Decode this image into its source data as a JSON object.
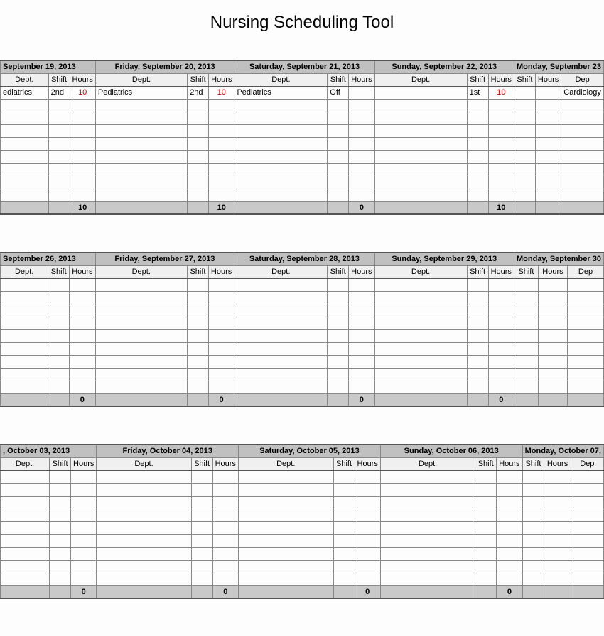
{
  "title": "Nursing Scheduling Tool",
  "labels": {
    "dept": "Dept.",
    "shift": "Shift",
    "hours": "Hours",
    "dept_frag": "Dep"
  },
  "weeks": [
    {
      "days": [
        {
          "date": "September 19, 2013",
          "dept": "ediatrics",
          "shift": "2nd",
          "hours": "10",
          "total": "10",
          "frag": true
        },
        {
          "date": "Friday, September 20, 2013",
          "dept": "Pediatrics",
          "shift": "2nd",
          "hours": "10",
          "total": "10"
        },
        {
          "date": "Saturday, September 21, 2013",
          "dept": "Pediatrics",
          "shift": "Off",
          "hours": "",
          "total": "0"
        },
        {
          "date": "Sunday, September 22, 2013",
          "dept": "",
          "shift": "1st",
          "hours": "10",
          "total": "10"
        },
        {
          "date": "Monday, September 23",
          "dept": "Cardiology",
          "shift": "",
          "hours": "",
          "total": "",
          "endfrag": true
        }
      ]
    },
    {
      "days": [
        {
          "date": "September 26, 2013",
          "dept": "",
          "shift": "",
          "hours": "",
          "total": "0",
          "frag": true
        },
        {
          "date": "Friday, September 27, 2013",
          "dept": "",
          "shift": "",
          "hours": "",
          "total": "0"
        },
        {
          "date": "Saturday, September 28, 2013",
          "dept": "",
          "shift": "",
          "hours": "",
          "total": "0"
        },
        {
          "date": "Sunday, September 29, 2013",
          "dept": "",
          "shift": "",
          "hours": "",
          "total": "0"
        },
        {
          "date": "Monday, September 30",
          "dept": "",
          "shift": "",
          "hours": "",
          "total": "",
          "endfrag": true
        }
      ]
    },
    {
      "days": [
        {
          "date": ", October 03, 2013",
          "dept": "",
          "shift": "",
          "hours": "",
          "total": "0",
          "frag": true
        },
        {
          "date": "Friday, October 04, 2013",
          "dept": "",
          "shift": "",
          "hours": "",
          "total": "0"
        },
        {
          "date": "Saturday, October 05, 2013",
          "dept": "",
          "shift": "",
          "hours": "",
          "total": "0"
        },
        {
          "date": "Sunday, October 06, 2013",
          "dept": "",
          "shift": "",
          "hours": "",
          "total": "0"
        },
        {
          "date": "Monday, October 07,",
          "dept": "",
          "shift": "",
          "hours": "",
          "total": "",
          "endfrag": true
        }
      ]
    }
  ],
  "empty_rows": 9
}
